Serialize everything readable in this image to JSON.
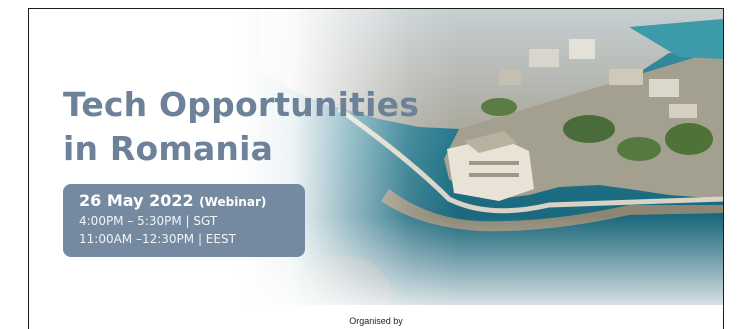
{
  "banner": {
    "title_line1": "Tech Opportunities",
    "title_line2": "in Romania",
    "title_color": "#6d8298",
    "card_color": "#758aa0",
    "event_date": "26 May 2022",
    "event_format": "(Webinar)",
    "time_sgt": "4:00PM – 5:30PM | SGT",
    "time_eest": "11:00AM –12:30PM | EEST",
    "photo": "coastal-city-aerial-photo"
  },
  "footer": {
    "organised_by": "Organised by"
  }
}
